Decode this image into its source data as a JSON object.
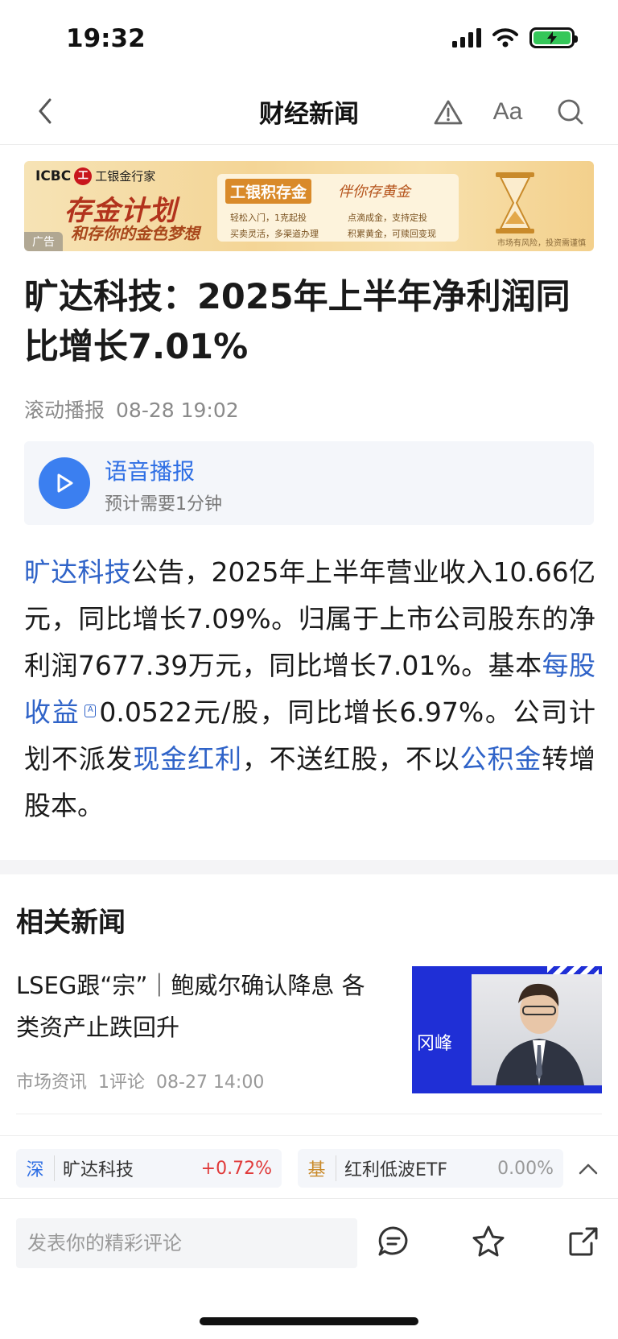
{
  "status_bar": {
    "time": "19:32"
  },
  "nav": {
    "title": "财经新闻",
    "font_button": "Aa"
  },
  "ad": {
    "brand": "ICBC",
    "bank_name": "工银金行家",
    "headline": "存金计划",
    "subline": "和存你的金色梦想",
    "panel_title": "工银积存金",
    "panel_slogan": "伴你存黄金",
    "features": [
      "轻松入门，1克起投",
      "点滴成金，支持定投",
      "买卖灵活，多渠道办理",
      "积累黄金，可赎回变现"
    ],
    "risk_note": "市场有风险，投资需谨慎",
    "tag": "广告"
  },
  "article": {
    "title": "旷达科技：2025年上半年净利润同比增长7.01%",
    "source": "滚动播报",
    "time": "08-28 19:02",
    "audio": {
      "title": "语音播报",
      "duration": "预计需要1分钟"
    },
    "body": {
      "link_company": "旷达科技",
      "part1": "公告，2025年上半年营业收入10.66亿元，同比增长7.09%。归属于上市公司股东的净利润7677.39万元，同比增长7.01%。基本",
      "link_eps": "每股收益",
      "part2": "0.0522元/股，同比增长6.97%。公司计划不派发",
      "link_dividend": "现金红利",
      "part3": "，不送红股，不以",
      "link_reserve": "公积金",
      "part4": "转增股本。"
    }
  },
  "related": {
    "title": "相关新闻",
    "items": [
      {
        "headline": "LSEG跟“宗”｜鲍威尔确认降息 各类资产止跌回升",
        "category": "市场资讯",
        "comments": "1评论",
        "time": "08-27 14:00",
        "thumb_label": "冈峰"
      }
    ]
  },
  "tickers": [
    {
      "market": "深",
      "name": "旷达科技",
      "change": "+0.72%",
      "color": "#e03a3a"
    },
    {
      "market": "基",
      "name": "红利低波ETF",
      "change": "0.00%",
      "color": "#999999"
    }
  ],
  "comment_bar": {
    "placeholder": "发表你的精彩评论"
  },
  "colors": {
    "link": "#2f63c8",
    "accent": "#3b7ff0",
    "up": "#e03a3a"
  }
}
